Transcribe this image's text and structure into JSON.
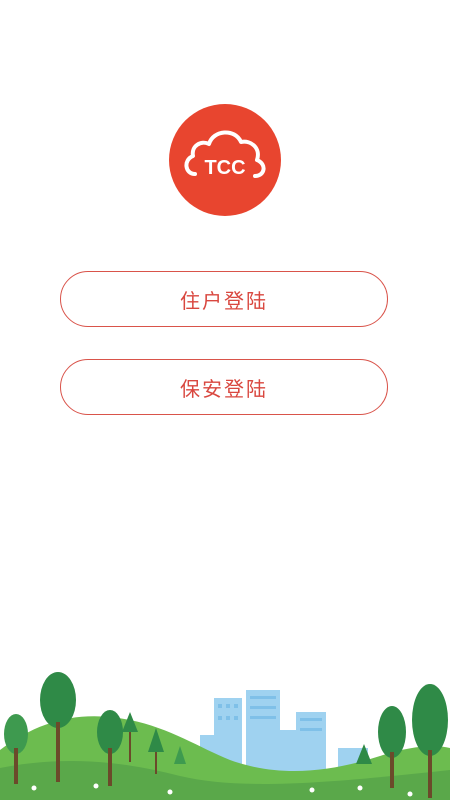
{
  "logo": {
    "text": "TCC",
    "bg_color": "#e8452f",
    "icon": "cloud-icon"
  },
  "buttons": {
    "resident_login": "住户登陆",
    "security_login": "保安登陆",
    "accent_color": "#d9473f"
  },
  "illustration": {
    "description_icon": "city-park-illustration"
  }
}
